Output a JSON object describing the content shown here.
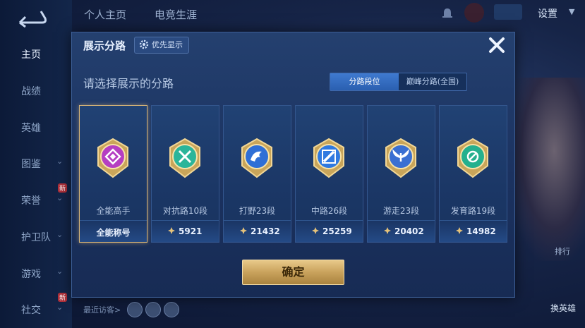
{
  "nav": {
    "items": [
      {
        "label": "主页",
        "active": true,
        "chevron": false,
        "badge": ""
      },
      {
        "label": "战绩",
        "active": false,
        "chevron": false,
        "badge": ""
      },
      {
        "label": "英雄",
        "active": false,
        "chevron": false,
        "badge": ""
      },
      {
        "label": "图鉴",
        "active": false,
        "chevron": true,
        "badge": ""
      },
      {
        "label": "荣誉",
        "active": false,
        "chevron": true,
        "badge": "新"
      },
      {
        "label": "护卫队",
        "active": false,
        "chevron": true,
        "badge": ""
      },
      {
        "label": "游戏",
        "active": false,
        "chevron": true,
        "badge": ""
      },
      {
        "label": "社交",
        "active": false,
        "chevron": true,
        "badge": "新"
      }
    ]
  },
  "top": {
    "tabs": [
      "个人主页",
      "电竞生涯"
    ],
    "settings_label": "设置"
  },
  "background": {
    "ranking_label": "排行",
    "hero_label": "换英雄",
    "visitors_label": "最近访客>"
  },
  "modal": {
    "title": "展示分路",
    "priority_label": "优先显示",
    "prompt": "请选择展示的分路",
    "segments": [
      {
        "label": "分路段位",
        "active": true
      },
      {
        "label": "巅峰分路(全国)",
        "active": false
      }
    ],
    "cards": [
      {
        "name": "全能高手",
        "footer": "全能称号",
        "value": "",
        "selected": true,
        "badge_color": "#b53ec2",
        "symbol": "square"
      },
      {
        "name": "对抗路10段",
        "footer": "",
        "value": "5921",
        "selected": false,
        "badge_color": "#2bb59a",
        "symbol": "cross"
      },
      {
        "name": "打野23段",
        "footer": "",
        "value": "21432",
        "selected": false,
        "badge_color": "#2f6fd6",
        "symbol": "dragon"
      },
      {
        "name": "中路26段",
        "footer": "",
        "value": "25259",
        "selected": false,
        "badge_color": "#2f79e0",
        "symbol": "slash"
      },
      {
        "name": "游走23段",
        "footer": "",
        "value": "20402",
        "selected": false,
        "badge_color": "#3a6fd2",
        "symbol": "wings"
      },
      {
        "name": "发育路19段",
        "footer": "",
        "value": "14982",
        "selected": false,
        "badge_color": "#24b08e",
        "symbol": "circle"
      }
    ],
    "confirm_label": "确定"
  }
}
